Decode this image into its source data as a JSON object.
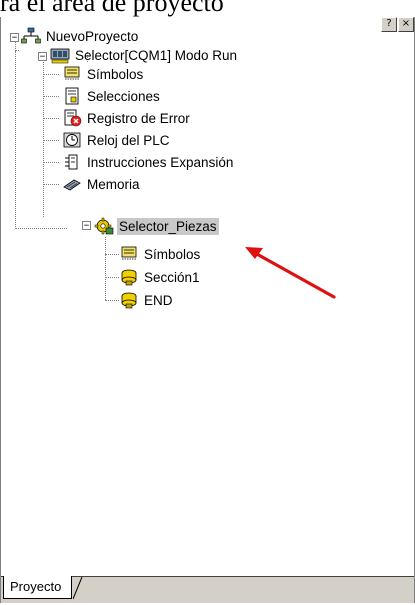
{
  "caption": "ra el área de proyecto",
  "window_buttons": [
    "?",
    "×"
  ],
  "tree": {
    "root": "NuevoProyecto",
    "plc": "Selector[CQM1] Modo Run",
    "plc_children": [
      {
        "label": "Símbolos",
        "icon": "symbols-icon"
      },
      {
        "label": "Selecciones",
        "icon": "settings-icon"
      },
      {
        "label": "Registro de Error",
        "icon": "error-log-icon"
      },
      {
        "label": "Reloj del PLC",
        "icon": "clock-icon"
      },
      {
        "label": "Instrucciones Expansión",
        "icon": "expansion-icon"
      },
      {
        "label": "Memoria",
        "icon": "memory-icon"
      }
    ],
    "program": "Selector_Piezas",
    "program_children": [
      {
        "label": "Símbolos",
        "icon": "symbols-icon"
      },
      {
        "label": "Sección1",
        "icon": "section-icon"
      },
      {
        "label": "END",
        "icon": "section-icon"
      }
    ]
  },
  "tab": "Proyecto",
  "colors": {
    "arrow": "#e01010",
    "selection": "#c8c8c8"
  }
}
